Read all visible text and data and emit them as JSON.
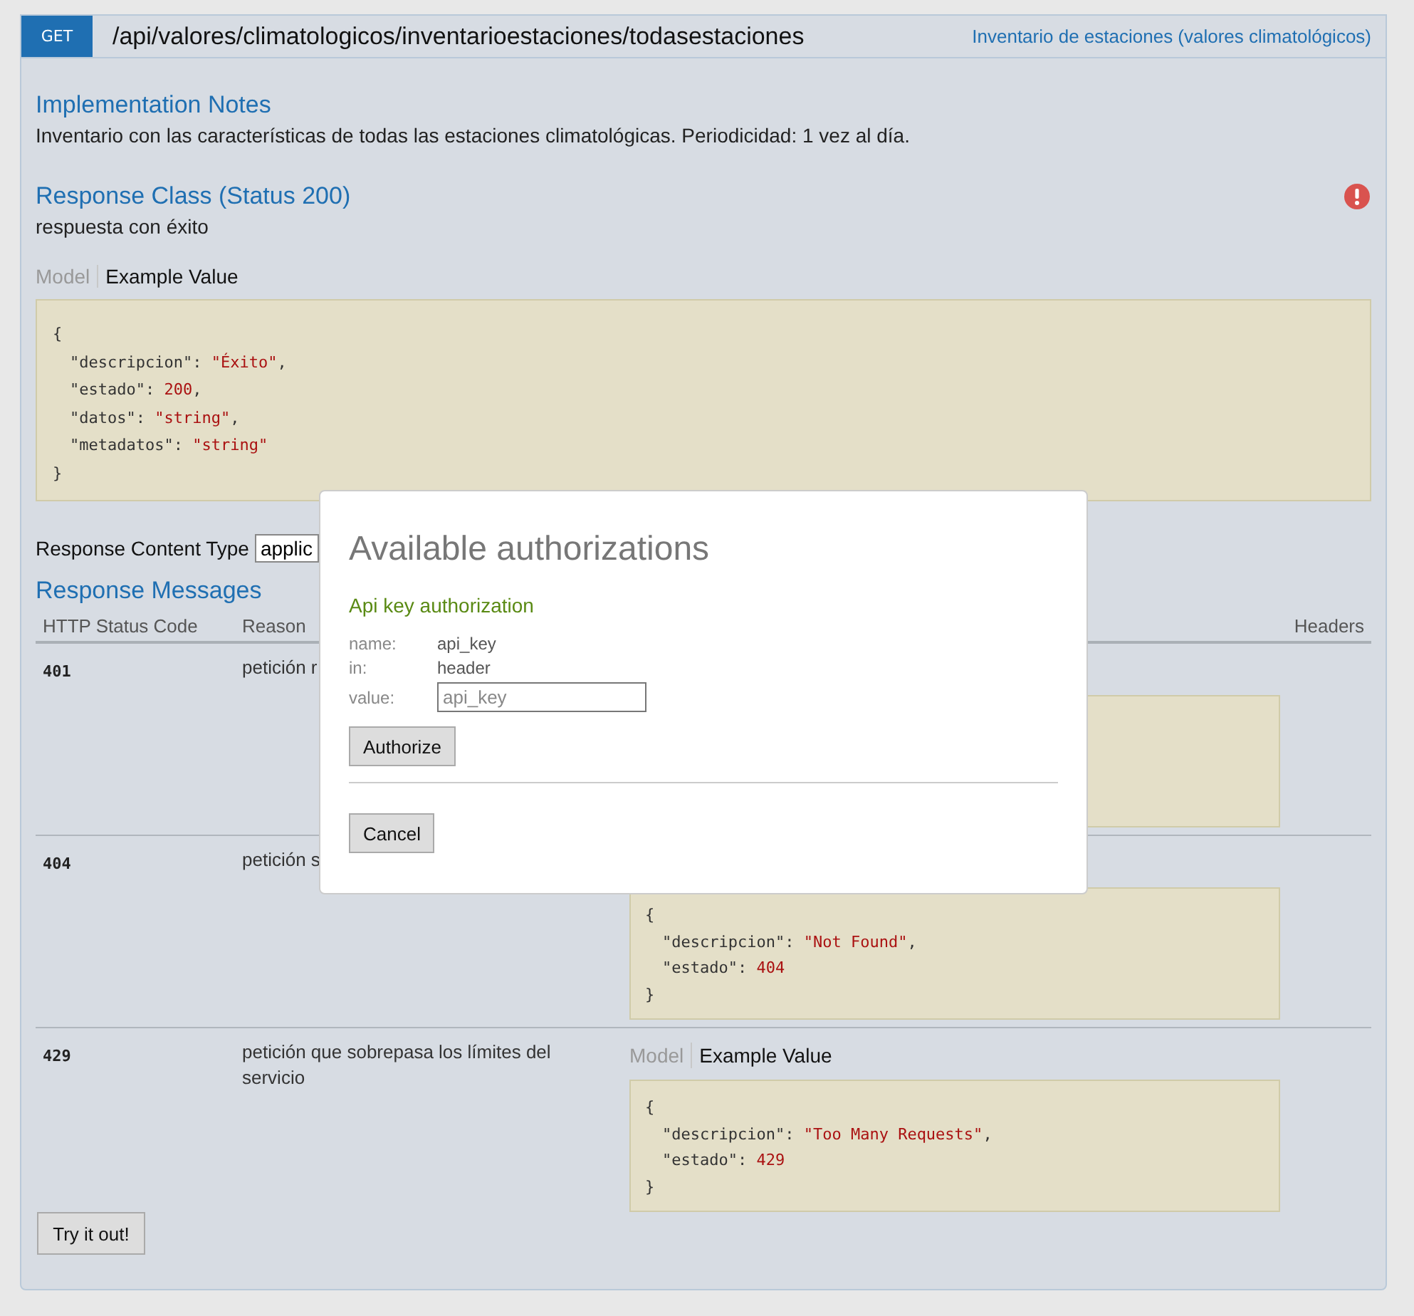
{
  "operation": {
    "method": "GET",
    "path": "/api/valores/climatologicos/inventarioestaciones/todasestaciones",
    "summary": "Inventario de estaciones (valores climatológicos)"
  },
  "implementation_notes": {
    "title": "Implementation Notes",
    "text": "Inventario con las características de todas las estaciones climatológicas. Periodicidad: 1 vez al día."
  },
  "response_class": {
    "title": "Response Class (Status 200)",
    "description": "respuesta con éxito",
    "tabs": [
      {
        "label": "Model",
        "selected": false
      },
      {
        "label": "Example Value",
        "selected": true
      }
    ],
    "example": {
      "open": "{",
      "close": "}",
      "fields": [
        {
          "key": "\"descripcion\":",
          "value": "\"Éxito\"",
          "punct": ","
        },
        {
          "key": "\"estado\":",
          "value": "200",
          "punct": ","
        },
        {
          "key": "\"datos\":",
          "value": "\"string\"",
          "punct": ","
        },
        {
          "key": "\"metadatos\":",
          "value": "\"string\""
        }
      ]
    }
  },
  "response_content_type": {
    "label": "Response Content Type",
    "value": "applic"
  },
  "response_messages": {
    "title": "Response Messages",
    "columns": [
      "HTTP Status Code",
      "Reason",
      "Headers"
    ],
    "rows": [
      {
        "kind": "covered",
        "code": "401",
        "reason": "petición r"
      },
      {
        "kind": "example",
        "code": "404",
        "reason": "petición s",
        "example": {
          "open": "{",
          "close": "}",
          "fields": [
            {
              "key": "\"descripcion\":",
              "value": "\"Not Found\"",
              "punct": ","
            },
            {
              "key": "\"estado\":",
              "value": "404"
            }
          ]
        }
      },
      {
        "kind": "example",
        "code": "429",
        "reason": "petición que sobrepasa los límites del servicio",
        "tabs": [
          {
            "label": "Model",
            "selected": false
          },
          {
            "label": "Example Value",
            "selected": true
          }
        ],
        "example": {
          "open": "{",
          "close": "}",
          "fields": [
            {
              "key": "\"descripcion\":",
              "value": "\"Too Many Requests\"",
              "punct": ","
            },
            {
              "key": "\"estado\":",
              "value": "429"
            }
          ]
        }
      }
    ]
  },
  "try_button": "Try it out!",
  "auth_dialog": {
    "title": "Available authorizations",
    "subtitle": "Api key authorization",
    "fields": [
      {
        "label": "name:",
        "value": "api_key"
      },
      {
        "label": "in:",
        "value": "header"
      }
    ],
    "input": {
      "label": "value:",
      "placeholder": "api_key"
    },
    "authorize_button": "Authorize",
    "cancel_button": "Cancel"
  }
}
